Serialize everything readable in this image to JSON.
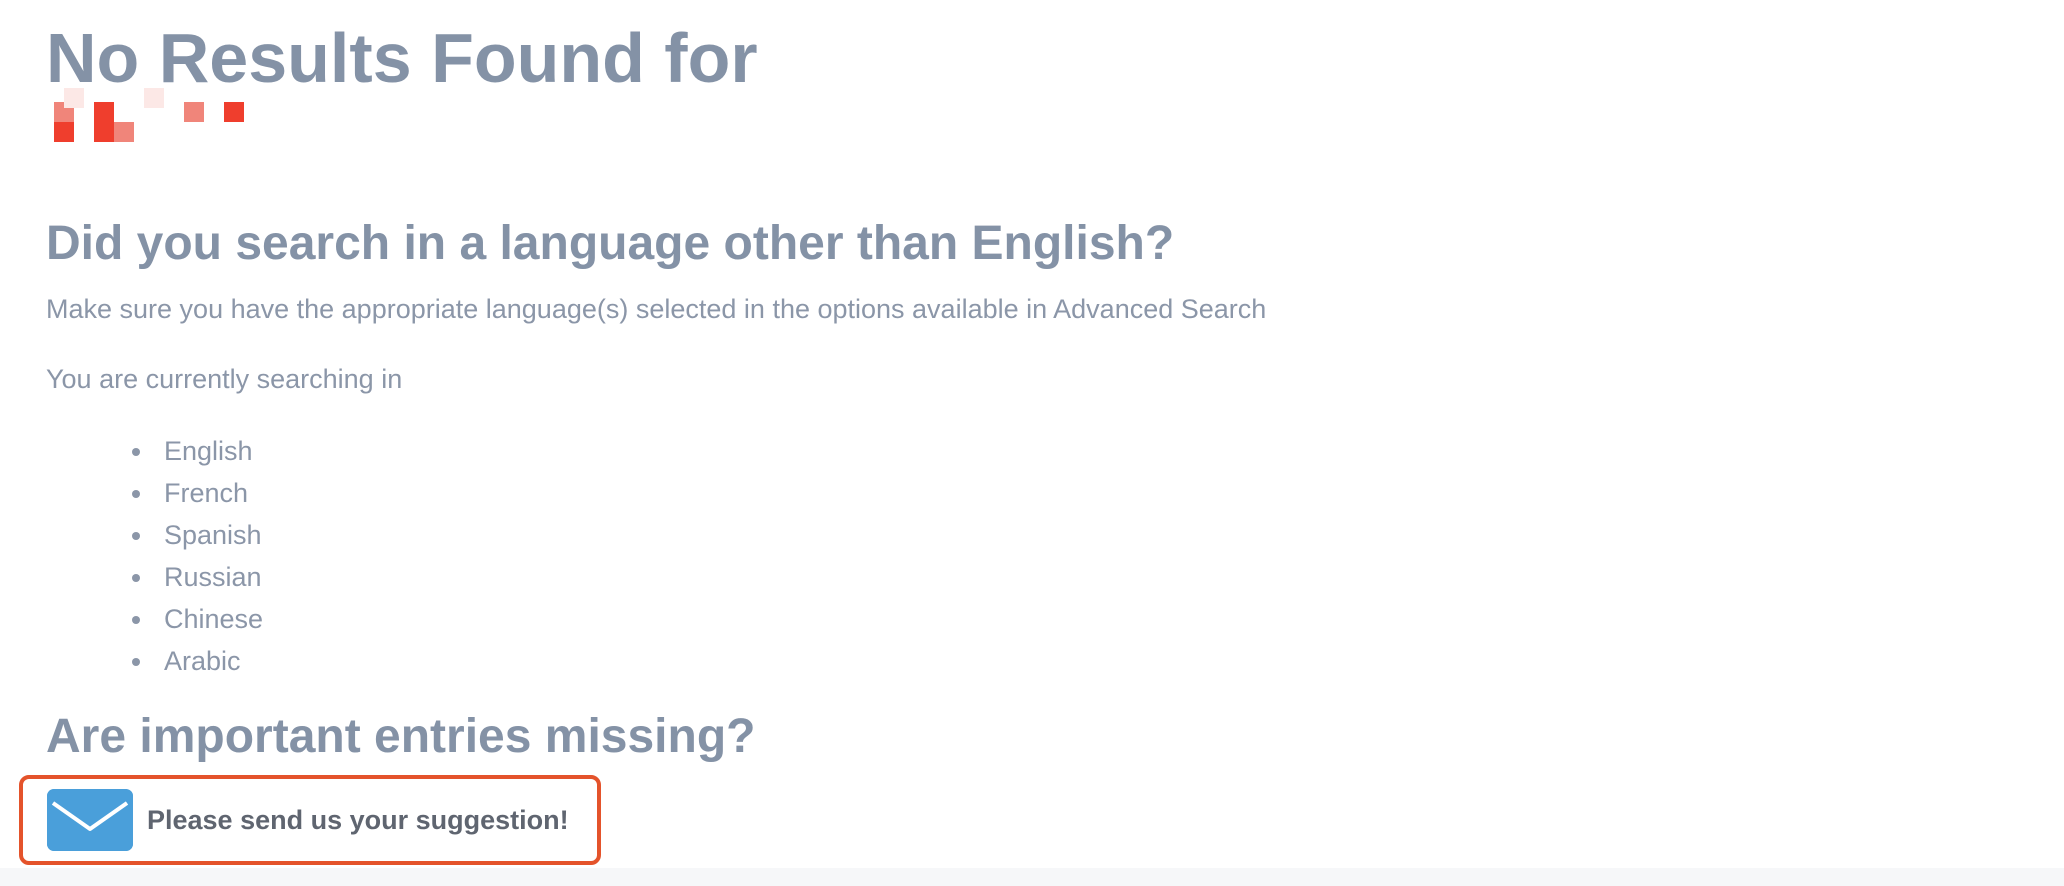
{
  "title": "No Results Found for",
  "query_term": {
    "text": "",
    "appearance": "pixelated-redacted",
    "colors": [
      "#ef3e2d",
      "#f0857a",
      "#fce8e6"
    ]
  },
  "language_section": {
    "heading": "Did you search in a language other than English?",
    "hint": "Make sure you have the appropriate language(s) selected in the options available in Advanced Search",
    "current_label": "You are currently searching in",
    "languages": [
      "English",
      "French",
      "Spanish",
      "Russian",
      "Chinese",
      "Arabic"
    ]
  },
  "missing_section": {
    "heading": "Are important entries missing?",
    "suggestion_label": "Please send us your suggestion!",
    "icon": "envelope-icon"
  },
  "colors": {
    "heading": "#8492a6",
    "body_text": "#8b96a8",
    "highlight_border": "#e4532b",
    "envelope": "#4a9fda",
    "suggestion_text": "#5f6570"
  }
}
